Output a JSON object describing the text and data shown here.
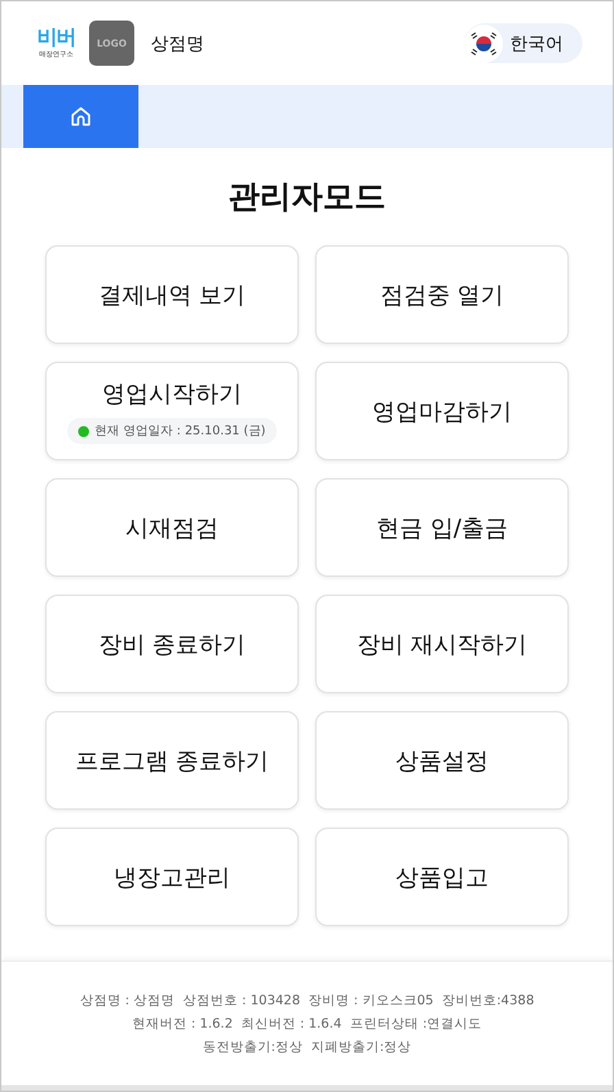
{
  "header": {
    "brand": {
      "mark": "비버",
      "sub": "매장연구소"
    },
    "logo": "LOGO",
    "store_name": "상점명",
    "language": "한국어"
  },
  "nav": {
    "tabs": [
      {
        "kind": "home",
        "selected": true
      }
    ]
  },
  "title": "관리자모드",
  "buttons": [
    {
      "label": "결제내역 보기"
    },
    {
      "label": "점검중 열기"
    },
    {
      "label": "영업시작하기",
      "status": {
        "text": "현재 영업일자 : 25.10.31 (금)",
        "color": "#22bb22"
      }
    },
    {
      "label": "영업마감하기"
    },
    {
      "label": "시재점검"
    },
    {
      "label": "현금 입/출금"
    },
    {
      "label": "장비 종료하기"
    },
    {
      "label": "장비 재시작하기"
    },
    {
      "label": "프로그램 종료하기"
    },
    {
      "label": "상품설정"
    },
    {
      "label": "냉장고관리"
    },
    {
      "label": "상품입고"
    }
  ],
  "footer": [
    [
      "상점명 : 상점명",
      "상점번호 : 103428",
      "장비명 : 키오스크05",
      "장비번호:4388"
    ],
    [
      "현재버전 : 1.6.2",
      "최신버전 : 1.6.4",
      "프린터상태 :연결시도"
    ],
    [
      "동전방출기:정상",
      "지폐방출기:정상"
    ]
  ]
}
